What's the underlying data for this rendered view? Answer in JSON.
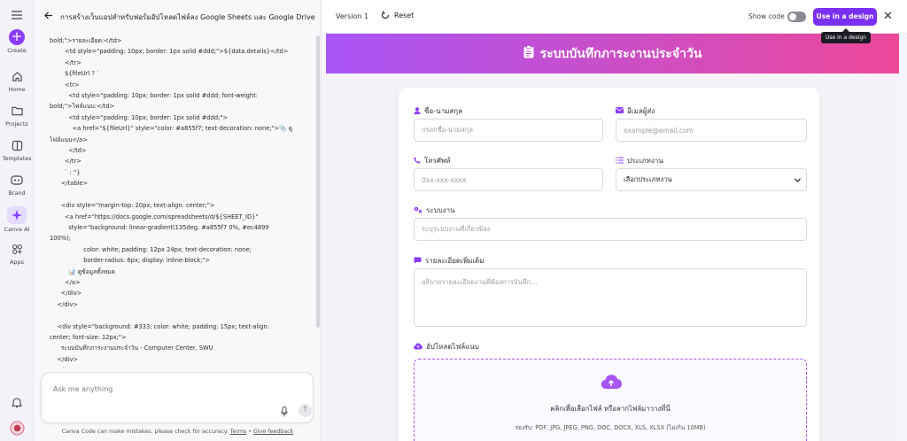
{
  "rail": {
    "items": [
      {
        "label": "Create"
      },
      {
        "label": "Home"
      },
      {
        "label": "Projects"
      },
      {
        "label": "Templates"
      },
      {
        "label": "Brand"
      },
      {
        "label": "Canva AI"
      },
      {
        "label": "Apps"
      }
    ]
  },
  "chat": {
    "title": "การสร้างเว็บแอปสำหรับฟอร์มอัปโหลดไฟล์ลง Google Sheets และ Google Drive",
    "code_lines": [
      "bold;\">รายละเอียด:</td>",
      "        <td style=\"padding: 10px; border: 1px solid #ddd;\">${data.details}</td>",
      "        </tr>",
      "        ${fileUrl ? `",
      "        <tr>",
      "          <td style=\"padding: 10px; border: 1px solid #ddd; font-weight:",
      "bold;\">ไฟล์แนบ:</td>",
      "          <td style=\"padding: 10px; border: 1px solid #ddd;\">",
      "            <a href=\"${fileUrl}\" style=\"color: #a855f7; text-decoration: none;\">📎 ดู",
      "ไฟล์แนบ</a>",
      "          </td>",
      "        </tr>",
      "        ` : ''}",
      "      </table>",
      "",
      "      <div style=\"margin-top: 20px; text-align: center;\">",
      "        <a href=\"https://docs.google.com/spreadsheets/d/${SHEET_ID}\"",
      "          style=\"background: linear-gradient(135deg, #a855f7 0%, #ec4899",
      "100%);",
      "                  color: white; padding: 12px 24px; text-decoration: none;",
      "                  border-radius: 6px; display: inline-block;\">",
      "          📊 ดูข้อมูลทั้งหมด",
      "        </a>",
      "      </div>",
      "    </div>",
      "",
      "    <div style=\"background: #333; color: white; padding: 15px; text-align:",
      "center; font-size: 12px;\">",
      "      ระบบบันทึกภาระงานประจำวัน - Computer Center, SWU",
      "    </div>",
      "  </div>"
    ],
    "input_placeholder": "Ask me anything",
    "disclaimer": "Canva Code can make mistakes, please check for accuracy.",
    "terms_label": "Terms",
    "feedback_label": "Give feedback",
    "separator": "•"
  },
  "topbar": {
    "version": "Version 1",
    "reset": "Reset",
    "show_code": "Show code",
    "use_button": "Use in a design",
    "tooltip": "Use in a design"
  },
  "form": {
    "banner_title": "ระบบบันทึกภาระงานประจำวัน",
    "name_label": "ชื่อ-นามสกุล",
    "name_placeholder": "กรอกชื่อ-นามสกุล",
    "email_label": "อีเมลผู้ส่ง",
    "email_placeholder": "example@email.com",
    "phone_label": "โทรศัพท์",
    "phone_placeholder": "0xx-xxx-xxxx",
    "worktype_label": "ประเภทงาน",
    "worktype_value": "เลือกประเภทงาน",
    "system_label": "ระบบงาน",
    "system_placeholder": "ระบุระบบงานที่เกี่ยวข้อง",
    "details_label": "รายละเอียดเพิ่มเติม",
    "details_placeholder": "อธิบายรายละเอียดงานที่ต้องการบันทึก...",
    "upload_label": "อัปโหลดไฟล์แนบ",
    "upload_text": "คลิกเพื่อเลือกไฟล์ หรือลากไฟล์มาวางที่นี่",
    "upload_formats": "รองรับ: PDF, JPG, JPEG, PNG, DOC, DOCX, XLS, XLSX (ไม่เกิน 10MB)"
  },
  "colors": {
    "accent": "#8b3dff",
    "gradient_start": "#a855f7",
    "gradient_end": "#ec4899"
  }
}
